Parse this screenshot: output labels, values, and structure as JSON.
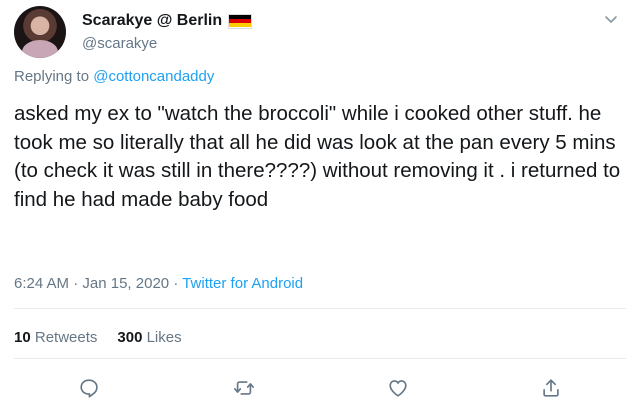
{
  "user": {
    "display_name": "Scarakye @ Berlin",
    "handle": "@scarakye",
    "flag_colors": [
      "#000000",
      "#dd0000",
      "#ffce00"
    ]
  },
  "reply": {
    "prefix": "Replying to",
    "mention": "@cottoncandaddy"
  },
  "tweet": {
    "text": "asked my ex to \"watch the broccoli\" while i cooked other stuff. he took me so literally that all he did was look at the pan every 5 mins (to check it was still in there????) without removing it . i returned to find he had made baby food"
  },
  "meta": {
    "time": "6:24 AM",
    "separator": "·",
    "date": "Jan 15, 2020",
    "source": "Twitter for Android"
  },
  "stats": {
    "retweets_count": "10",
    "retweets_label": "Retweets",
    "likes_count": "300",
    "likes_label": "Likes"
  },
  "icons": {
    "reply": "reply-icon",
    "retweet": "retweet-icon",
    "like": "heart-icon",
    "share": "share-icon",
    "more": "chevron-down-icon"
  },
  "colors": {
    "accent": "#1da1f2",
    "muted": "#657786",
    "text": "#14171a"
  }
}
